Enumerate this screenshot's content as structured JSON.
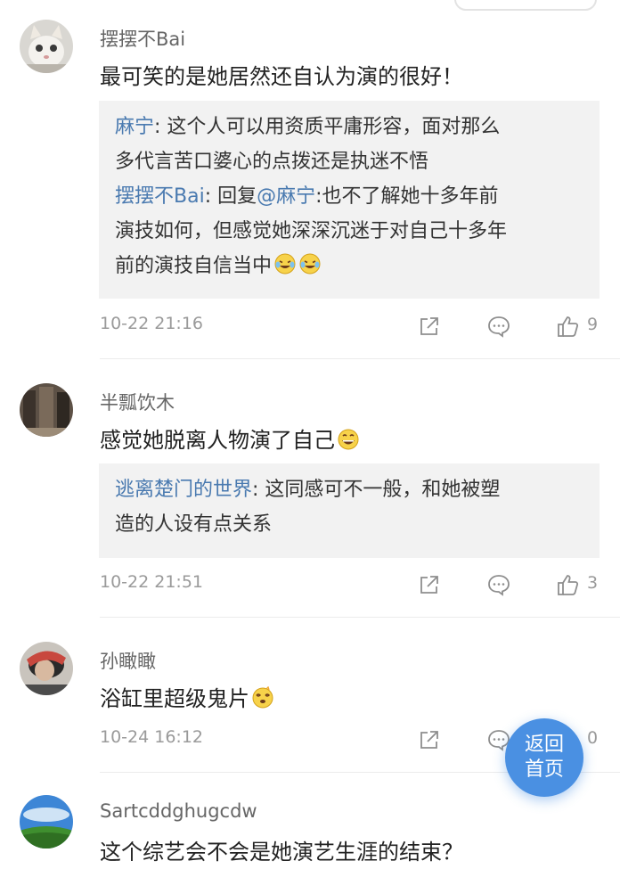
{
  "comments": [
    {
      "username": "摆摆不Bai",
      "content": "最可笑的是她居然还自认为演的很好！",
      "replies": [
        {
          "user": "麻宁",
          "sep": ": ",
          "lines": [
            "这个人可以用资质平庸形容，面对那么",
            "多代言苦口婆心的点拨还是执迷不悟"
          ]
        },
        {
          "user": "摆摆不Bai",
          "sep": ": 回复",
          "mention": "@麻宁",
          "text_after": ":也不了解她十多年前",
          "lines": [
            "演技如何，但感觉她深深沉迷于对自己十多年",
            "前的演技自信当中"
          ]
        }
      ],
      "time": "10-22 21:16",
      "likes": "9"
    },
    {
      "username": "半瓢饮木",
      "content": "感觉她脱离人物演了自己",
      "replies": [
        {
          "user": "逃离楚门的世界",
          "sep": ": ",
          "lines": [
            "这同感可不一般，和她被塑",
            "造的人设有点关系"
          ]
        }
      ],
      "time": "10-22 21:51",
      "likes": "3"
    },
    {
      "username": "孙瞰瞰",
      "content": "浴缸里超级鬼片",
      "time": "10-24 16:12",
      "likes": "0"
    },
    {
      "username": "Sartcddghugcdw",
      "content": "这个综艺会不会是她演艺生涯的结束？"
    }
  ],
  "float_button": {
    "line1": "返回",
    "line2": "首页"
  },
  "icons": {
    "share": "share-icon",
    "comment": "comment-icon",
    "like": "thumbs-up-icon",
    "emoji_laugh_cry": "laugh-cry-emoji-icon",
    "emoji_grin": "grin-emoji-icon",
    "emoji_dizzy": "dizzy-emoji-icon"
  },
  "colors": {
    "link": "#4a7ab0",
    "reply_bg": "#f2f2f2",
    "meta": "#9a9a9a",
    "float_button": "#4a90e2"
  }
}
